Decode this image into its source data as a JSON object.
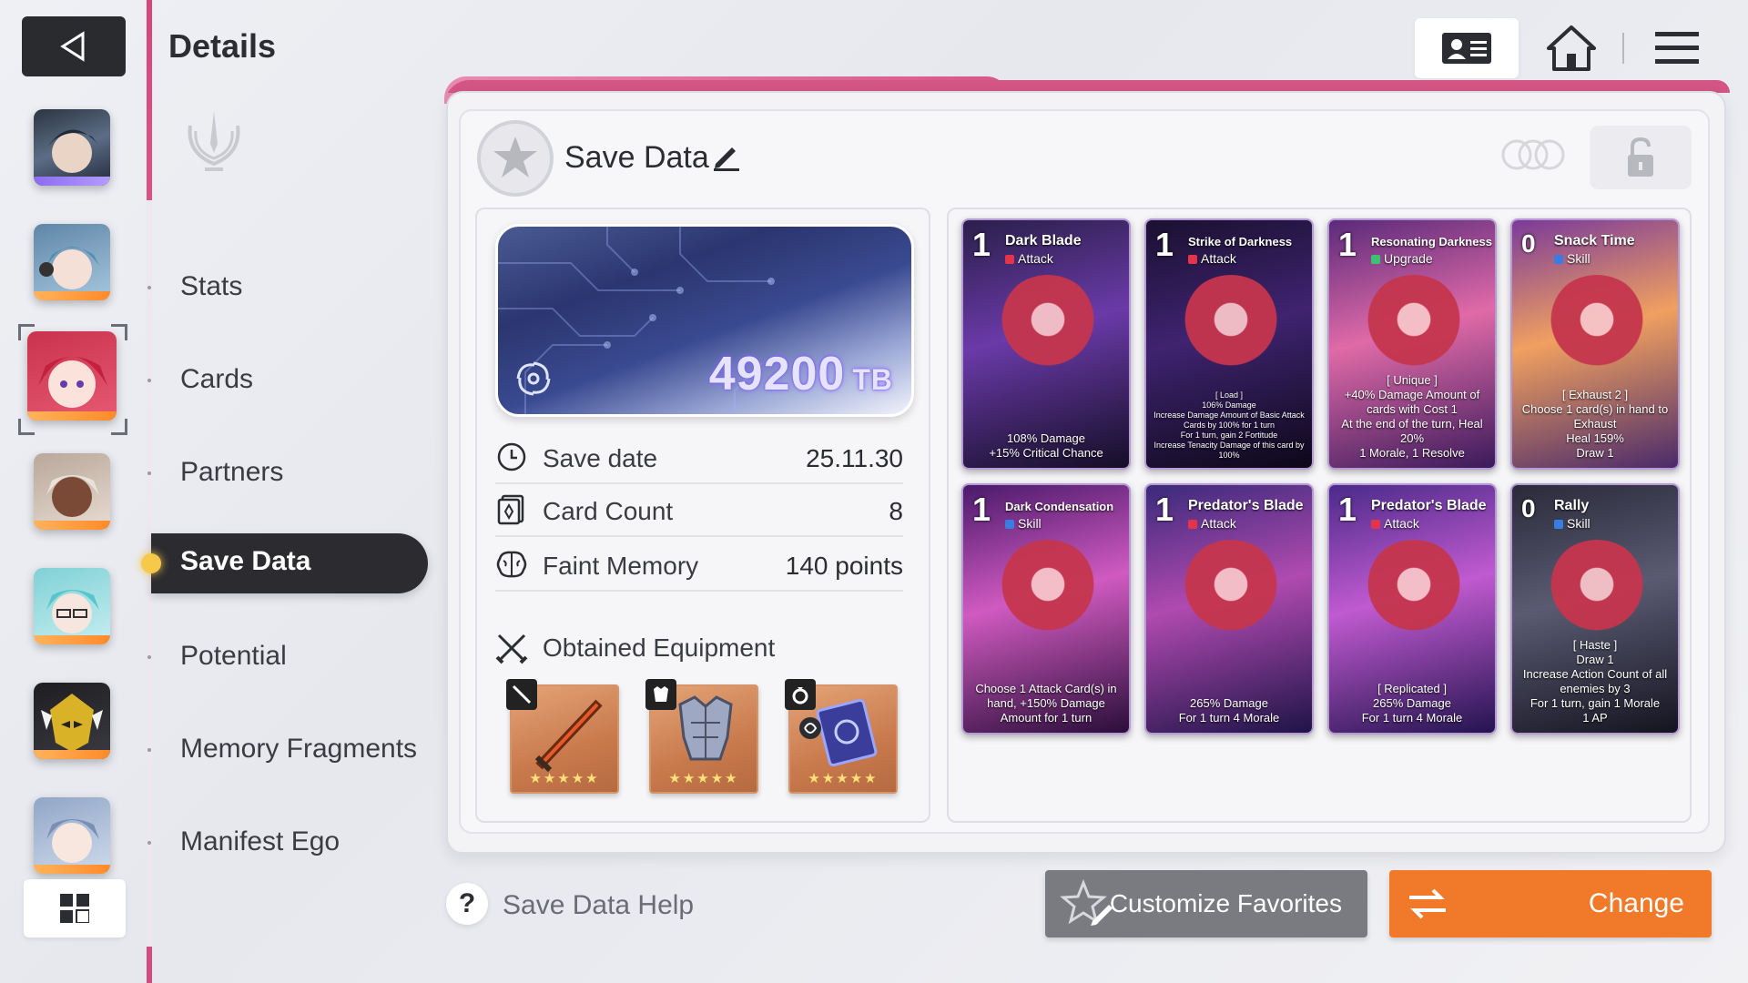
{
  "header": {
    "title": "Details"
  },
  "nav": {
    "items": [
      "Stats",
      "Cards",
      "Partners",
      "Save Data",
      "Potential",
      "Memory Fragments",
      "Manifest Ego"
    ],
    "active": "Save Data"
  },
  "save": {
    "title": "Save Data",
    "amount": "49200",
    "unit": "TB",
    "rows": [
      {
        "label": "Save date",
        "value": "25.11.30",
        "icon": "clock-icon"
      },
      {
        "label": "Card Count",
        "value": "8",
        "icon": "card-icon"
      },
      {
        "label": "Faint Memory",
        "value": "140 points",
        "icon": "brain-icon"
      }
    ],
    "equipment_title": "Obtained Equipment",
    "equipment": [
      {
        "name": "sword",
        "stars": "★★★★★"
      },
      {
        "name": "armor",
        "stars": "★★★★★"
      },
      {
        "name": "ring",
        "stars": "★★★★★"
      }
    ]
  },
  "cards": [
    {
      "cost": "1",
      "name": "Dark Blade",
      "type": "Attack",
      "kind": "attack",
      "desc": "108% Damage\n+15% Critical Chance",
      "colors": [
        "#2a1f4a",
        "#6a3aa8",
        "#140e26"
      ]
    },
    {
      "cost": "1",
      "name": "Strike of Darkness",
      "type": "Attack",
      "kind": "attack",
      "desc": "[ Load ]\n106% Damage\nIncrease Damage Amount of Basic Attack Cards by 100% for 1 turn\nFor 1 turn, gain 2 Fortitude\nIncrease Tenacity Damage of this card by 100%",
      "tiny": true,
      "colors": [
        "#1a1030",
        "#3f2370",
        "#0c0818"
      ]
    },
    {
      "cost": "1",
      "name": "Resonating Darkness",
      "type": "Upgrade",
      "kind": "upgrade",
      "desc": "[ Unique ]\n+40% Damage Amount of cards with Cost 1\nAt the end of the turn, Heal 20%\n1 Morale, 1 Resolve",
      "colors": [
        "#5a2a7a",
        "#e06aa8",
        "#3a1a5a"
      ]
    },
    {
      "cost": "0",
      "name": "Snack Time",
      "type": "Skill",
      "kind": "skill",
      "desc": "[ Exhaust 2 ]\nChoose 1 card(s) in hand to Exhaust\nHeal 159%\nDraw 1",
      "colors": [
        "#7a3a9a",
        "#f0a060",
        "#4a2a6a"
      ]
    },
    {
      "cost": "1",
      "name": "Dark Condensation",
      "type": "Skill",
      "kind": "skill",
      "desc": "Choose 1 Attack Card(s) in hand, +150% Damage Amount for 1 turn",
      "colors": [
        "#4a1a6a",
        "#d05ac0",
        "#2a0e3a"
      ]
    },
    {
      "cost": "1",
      "name": "Predator's Blade",
      "type": "Attack",
      "kind": "attack",
      "desc": "265% Damage\nFor 1 turn 4 Morale",
      "colors": [
        "#3a2a7a",
        "#b04ab0",
        "#1e1448"
      ]
    },
    {
      "cost": "1",
      "name": "Predator's Blade",
      "type": "Attack",
      "kind": "attack",
      "desc": "[ Replicated ]\n265% Damage\nFor 1 turn 4 Morale",
      "colors": [
        "#4a2a8a",
        "#c05ad0",
        "#241450"
      ]
    },
    {
      "cost": "0",
      "name": "Rally",
      "type": "Skill",
      "kind": "skill",
      "desc": "[ Haste ]\nDraw 1\nIncrease Action Count of all enemies by 3\nFor 1 turn, gain 1 Morale\n1 AP",
      "colors": [
        "#2a2a3a",
        "#5a5a72",
        "#141420"
      ]
    }
  ],
  "buttons": {
    "help": "Save Data Help",
    "favorites": "Customize Favorites",
    "change": "Change"
  },
  "accent": "#d5477a",
  "change_color": "#f07a2a"
}
